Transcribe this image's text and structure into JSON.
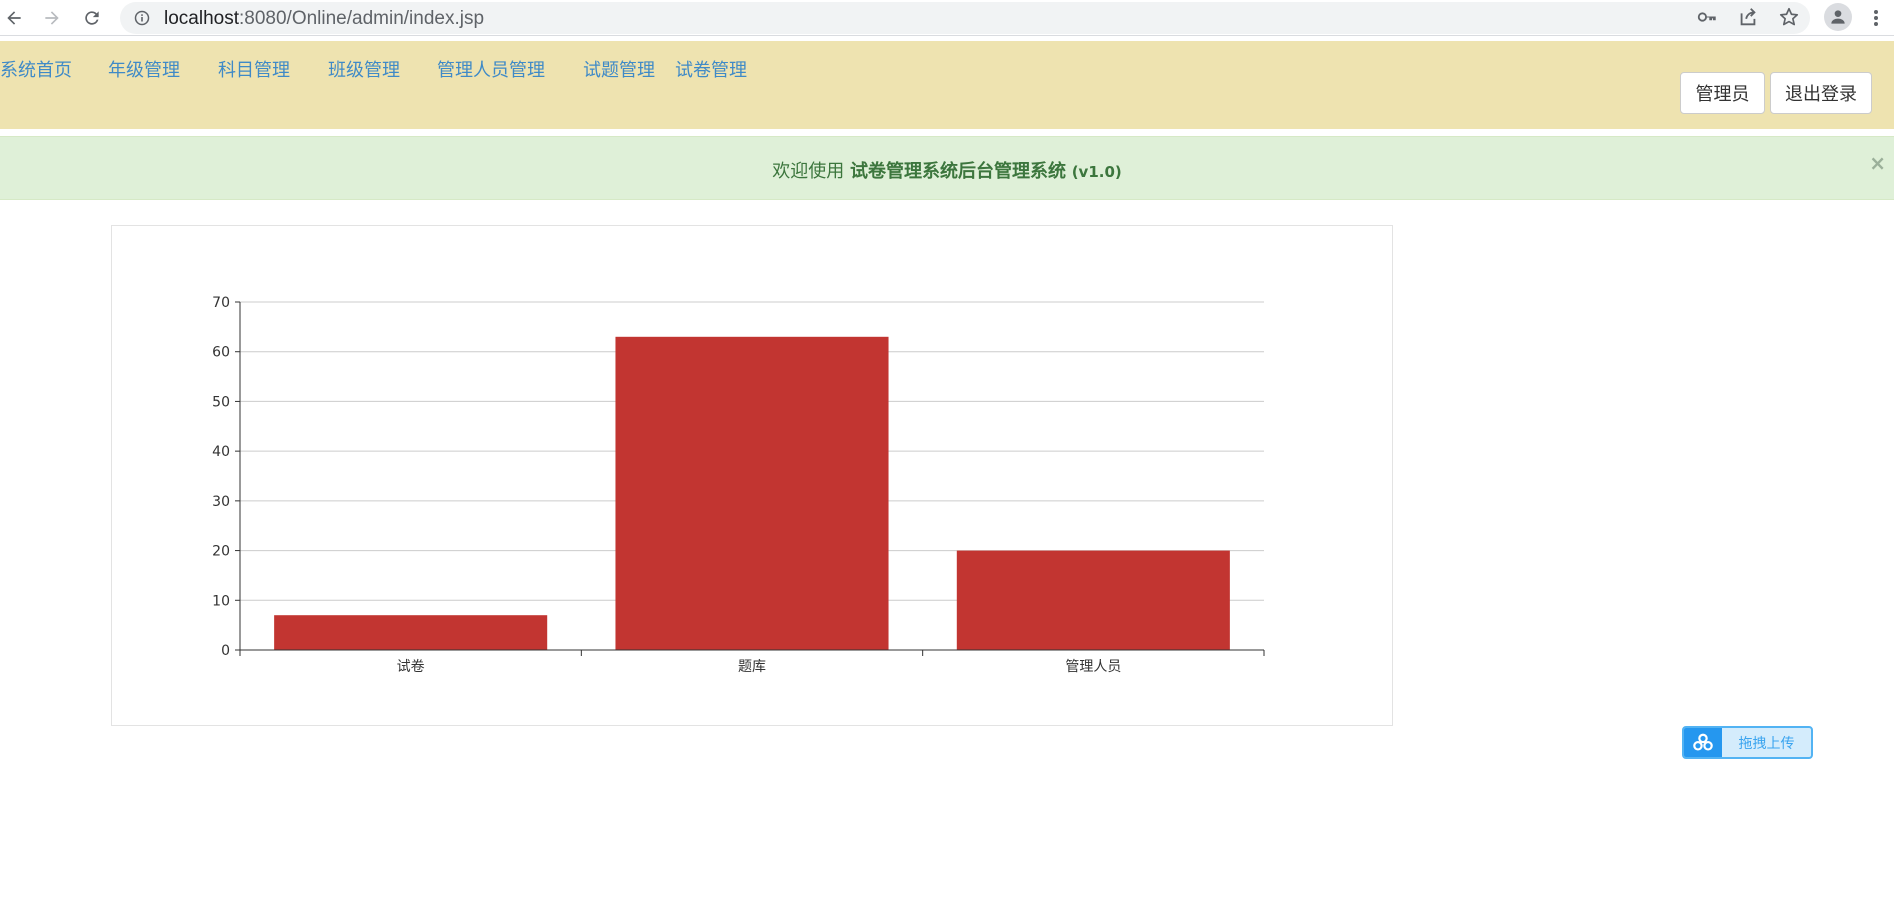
{
  "browser": {
    "url_host": "localhost",
    "url_path": ":8080/Online/admin/index.jsp"
  },
  "nav": {
    "items": [
      {
        "label": "系统首页"
      },
      {
        "label": "年级管理"
      },
      {
        "label": "科目管理"
      },
      {
        "label": "班级管理"
      },
      {
        "label": "管理人员管理"
      },
      {
        "label": "试题管理"
      },
      {
        "label": "试卷管理"
      }
    ],
    "admin_button": "管理员",
    "logout_button": "退出登录"
  },
  "alert": {
    "prefix": "欢迎使用 ",
    "system_name": "试卷管理系统后台管理系统",
    "version": "(v1.0)",
    "close": "×"
  },
  "chart_data": {
    "type": "bar",
    "categories": [
      "试卷",
      "题库",
      "管理人员"
    ],
    "values": [
      7,
      63,
      20
    ],
    "ylim": [
      0,
      70
    ],
    "yticks": [
      0,
      10,
      20,
      30,
      40,
      50,
      60,
      70
    ],
    "bar_color": "#c23531",
    "grid": true
  },
  "upload": {
    "label": "拖拽上传"
  },
  "colors": {
    "header_bg": "#eee3b0",
    "nav_link": "#3f8ac7",
    "alert_bg": "#dff0d8",
    "alert_text": "#3c763d"
  }
}
